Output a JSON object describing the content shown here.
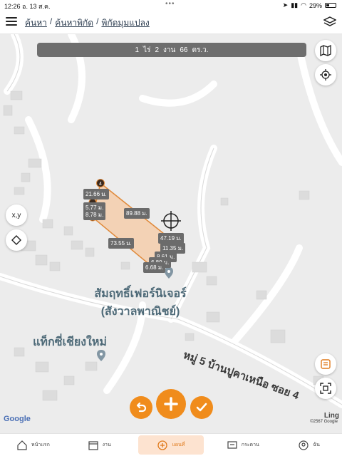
{
  "status": {
    "time": "12:26",
    "date": "อ. 13 ส.ค.",
    "battery": "29%"
  },
  "header": {
    "breadcrumb": [
      "ค้นหา",
      "ค้นหาพิกัด",
      "พิกัดมุมแปลง"
    ],
    "separator": "/"
  },
  "area": {
    "rai": "1",
    "rai_unit": "ไร่",
    "ngan": "2",
    "ngan_unit": "งาน",
    "wa": "66",
    "wa_unit": "ตร.ว."
  },
  "map_controls": {
    "xy_label": "x,y"
  },
  "measurements": [
    "21.66 ม.",
    "5.77 ม.",
    "8.78 ม.",
    "89.88 ม.",
    "73.55 ม.",
    "47.19 ม.",
    "11.35 ม.",
    "8.61 ม.",
    "6.80 ม.",
    "6.68 ม."
  ],
  "vertex_labels": [
    "4",
    "1"
  ],
  "poi": [
    {
      "line1": "สัมฤทธิ์เฟอร์นิเจอร์",
      "line2": "(สังวาลพาณิชย์)"
    },
    {
      "line1": "แท็กซี่เชียงใหม่"
    }
  ],
  "road_label": "หมู่ 5 บ้านปูคาเหนือ ซอย 4",
  "map_credits": {
    "google": "Google",
    "copyright": "©2567 Google",
    "ling": "Ling"
  },
  "bottom_nav": [
    {
      "label": "หน้าแรก",
      "icon": "home-icon"
    },
    {
      "label": "งาน",
      "icon": "calendar-icon"
    },
    {
      "label": "แผนที่",
      "icon": "plus-circle-icon",
      "active": true
    },
    {
      "label": "กระดาน",
      "icon": "board-icon"
    },
    {
      "label": "ฉัน",
      "icon": "user-icon"
    }
  ],
  "colors": {
    "accent": "#f08c1c",
    "plot_fill": "#f5c9a3",
    "plot_stroke": "#e08a3b",
    "banner": "#6e6e6e"
  }
}
